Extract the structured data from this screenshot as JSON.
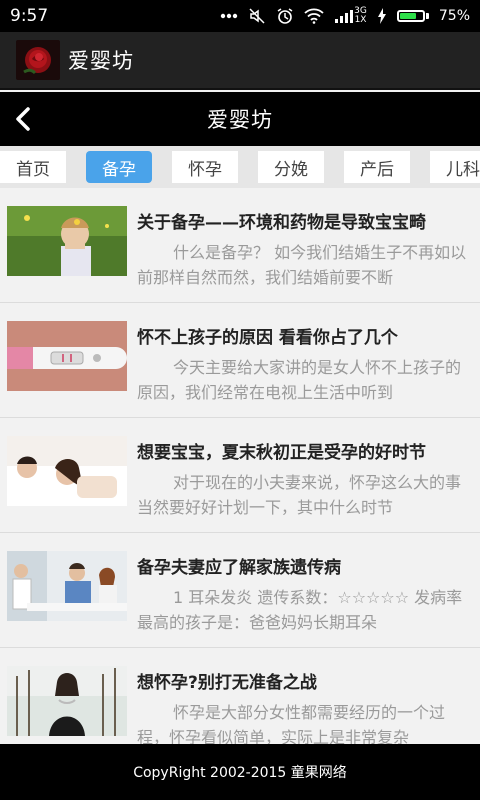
{
  "status_bar": {
    "time": "9:57",
    "network_type_top": "3G",
    "network_type_bottom": "1X",
    "battery_percent": "75%",
    "battery_level": 0.75,
    "battery_color": "#2ee04a",
    "icons": [
      "more-dots-icon",
      "mute-icon",
      "alarm-icon",
      "wifi-icon",
      "signal-icon",
      "charging-icon",
      "battery-icon"
    ]
  },
  "app_bar": {
    "title": "爱婴坊",
    "logo": "rose-logo"
  },
  "nav_bar": {
    "title": "爱婴坊",
    "back_icon": "chevron-left-icon"
  },
  "tabs": [
    {
      "label": "首页",
      "active": false
    },
    {
      "label": "备孕",
      "active": true
    },
    {
      "label": "怀孕",
      "active": false
    },
    {
      "label": "分娩",
      "active": false
    },
    {
      "label": "产后",
      "active": false
    },
    {
      "label": "儿科",
      "active": false
    }
  ],
  "accent_color": "#4aa3ea",
  "articles": [
    {
      "title": "关于备孕——环境和药物是导致宝宝畸",
      "summary": "什么是备孕？ 如今我们结婚生子不再如以前那样自然而然，我们结婚前要不断"
    },
    {
      "title": "怀不上孩子的原因 看看你占了几个",
      "summary": "今天主要给大家讲的是女人怀不上孩子的原因，我们经常在电视上生活中听到"
    },
    {
      "title": "想要宝宝，夏末秋初正是受孕的好时节",
      "summary": "对于现在的小夫妻来说，怀孕这么大的事当然要好好计划一下，其中什么时节"
    },
    {
      "title": "备孕夫妻应了解家族遗传病",
      "summary": "1 耳朵发炎 遗传系数：☆☆☆☆☆ 发病率最高的孩子是：爸爸妈妈长期耳朵"
    },
    {
      "title": "想怀孕?别打无准备之战",
      "summary": "怀孕是大部分女性都需要经历的一个过程，怀孕看似简单，实际上是非常复杂"
    }
  ],
  "footer": {
    "copyright": "CopyRight 2002-2015 童果网络"
  }
}
